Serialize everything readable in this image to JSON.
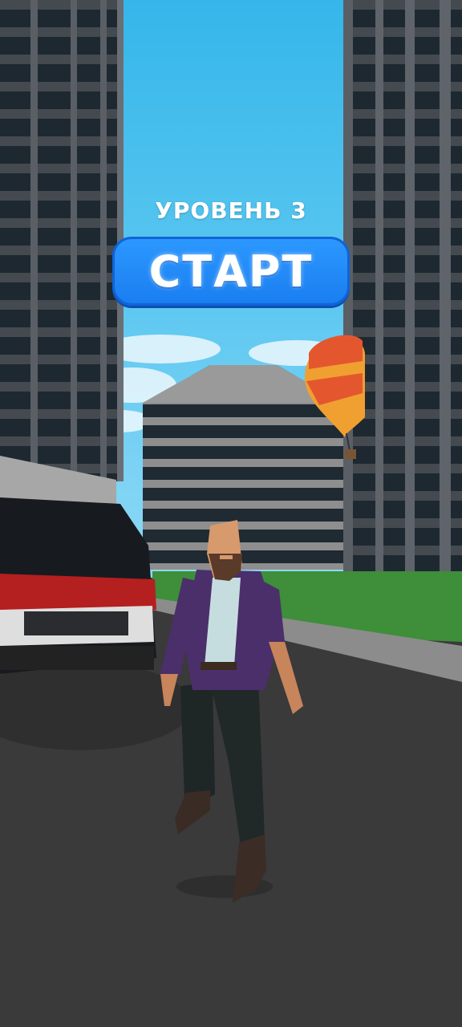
{
  "hud": {
    "level_text": "УРОВЕНЬ 3",
    "start_label": "СТАРТ"
  },
  "colors": {
    "sky": "#4fc3ee",
    "button": "#1e88f5",
    "road": "#3a3a3a",
    "grass": "#3e8e3a",
    "tower": "#3b3f44",
    "window": "#1d2730"
  },
  "scene": {
    "elements": [
      "left-tower",
      "right-tower",
      "center-building",
      "hot-air-balloon",
      "red-van",
      "player-character",
      "street"
    ]
  }
}
